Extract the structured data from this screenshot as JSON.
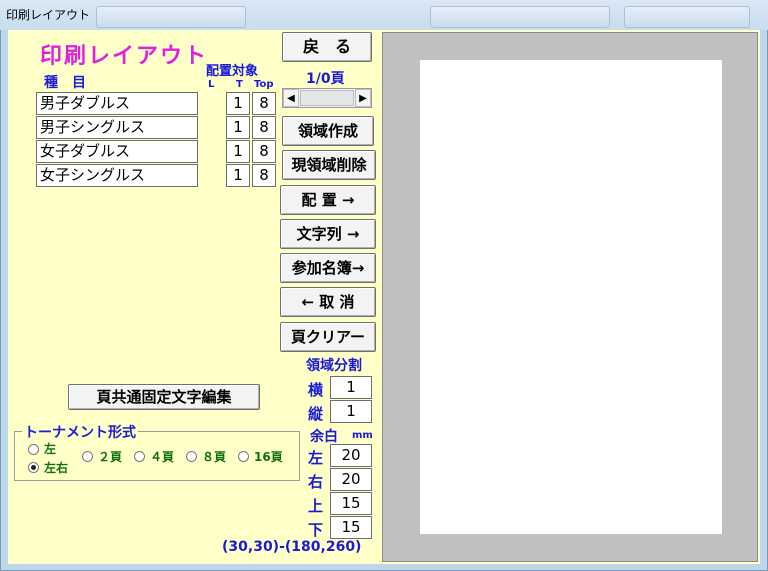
{
  "window": {
    "title": "印刷レイアウト",
    "ghost_buttons": [
      "",
      "",
      ""
    ]
  },
  "panel": {
    "title": "印刷レイアウト",
    "col_type": "種　目",
    "col_target": "配置対象",
    "col_L": "L",
    "col_T": "T",
    "col_Top": "Top",
    "rows": [
      {
        "name": "男子ダブルス",
        "t": "1",
        "top": "8"
      },
      {
        "name": "男子シングルス",
        "t": "1",
        "top": "8"
      },
      {
        "name": "女子ダブルス",
        "t": "1",
        "top": "8"
      },
      {
        "name": "女子シングルス",
        "t": "1",
        "top": "8"
      }
    ],
    "common_text_button": "頁共通固定文字編集",
    "tournament": {
      "title": "トーナメント形式",
      "opt_left": "左",
      "opt_leftright": "左右",
      "opt_2": "２頁",
      "opt_4": "４頁",
      "opt_8": "８頁",
      "opt_16": "16頁",
      "selected": "左右"
    }
  },
  "buttons": {
    "back": "戻　る",
    "page": "1/0頁",
    "create_area": "領域作成",
    "delete_area": "現領域削除",
    "place": "配 置 →",
    "text": "文字列 →",
    "participants": "参加名簿→",
    "cancel": "← 取 消",
    "clear_page": "頁クリアー"
  },
  "split": {
    "title": "領域分割",
    "h_label": "横",
    "h_value": "1",
    "v_label": "縦",
    "v_value": "1"
  },
  "margin": {
    "title": "余白",
    "unit": "mm",
    "left_label": "左",
    "left": "20",
    "right_label": "右",
    "right": "20",
    "top_label": "上",
    "top": "15",
    "bottom_label": "下",
    "bottom": "15"
  },
  "coords": "(30,30)-(180,260)"
}
